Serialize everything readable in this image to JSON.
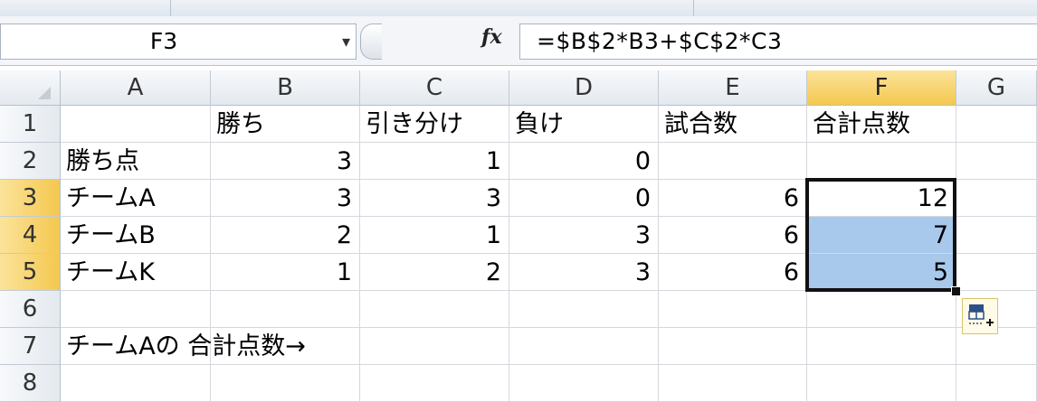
{
  "formula_bar": {
    "name_box": "F3",
    "name_box_dropdown_icon": "▾",
    "fx_icon": "fx",
    "formula": "=$B$2*B3+$C$2*C3"
  },
  "columns": [
    "A",
    "B",
    "C",
    "D",
    "E",
    "F",
    "G"
  ],
  "selected_column": "F",
  "rows": [
    {
      "num": "1",
      "cells": [
        "",
        "勝ち",
        "引き分け",
        "負け",
        "試合数",
        "合計点数"
      ]
    },
    {
      "num": "2",
      "cells": [
        "勝ち点",
        "3",
        "1",
        "0",
        "",
        ""
      ]
    },
    {
      "num": "3",
      "cells": [
        "チームA",
        "3",
        "3",
        "0",
        "6",
        "12"
      ]
    },
    {
      "num": "4",
      "cells": [
        "チームB",
        "2",
        "1",
        "3",
        "6",
        "7"
      ]
    },
    {
      "num": "5",
      "cells": [
        "チームK",
        "1",
        "2",
        "3",
        "6",
        "5"
      ]
    },
    {
      "num": "6",
      "cells": [
        "",
        "",
        "",
        "",
        "",
        ""
      ]
    },
    {
      "num": "7",
      "cells": [
        "チームAの 合計点数→",
        "",
        "",
        "",
        "",
        ""
      ]
    },
    {
      "num": "8",
      "cells": [
        "",
        "",
        "",
        "",
        "",
        ""
      ]
    }
  ],
  "selected_rows": [
    "3",
    "4",
    "5"
  ],
  "selection_range": "F3:F5",
  "colors": {
    "selection_fill": "#a8c8ec",
    "header_highlight": "#f4c84e"
  }
}
